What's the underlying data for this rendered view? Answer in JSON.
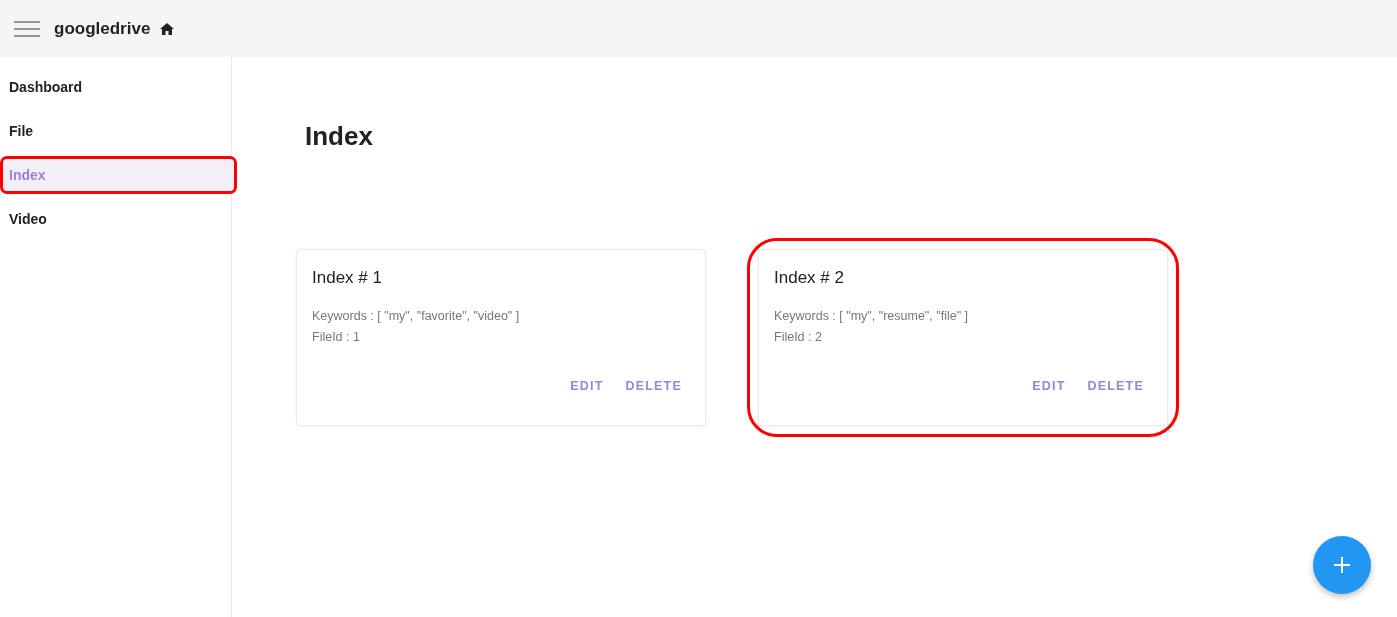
{
  "app_bar": {
    "title": "googledrive"
  },
  "sidebar": {
    "items": [
      {
        "label": "Dashboard",
        "selected": false,
        "highlighted": false
      },
      {
        "label": "File",
        "selected": false,
        "highlighted": false
      },
      {
        "label": "Index",
        "selected": true,
        "highlighted": true
      },
      {
        "label": "Video",
        "selected": false,
        "highlighted": false
      }
    ]
  },
  "page": {
    "title": "Index"
  },
  "cards": [
    {
      "title": "Index # 1",
      "lines": [
        "Keywords : [ \"my\", \"favorite\", \"video\" ]",
        "FileId : 1"
      ],
      "actions": [
        "EDIT",
        "DELETE"
      ],
      "highlighted": false
    },
    {
      "title": "Index # 2",
      "lines": [
        "Keywords : [ \"my\", \"resume\", \"file\" ]",
        "FileId : 2"
      ],
      "actions": [
        "EDIT",
        "DELETE"
      ],
      "highlighted": true
    }
  ]
}
